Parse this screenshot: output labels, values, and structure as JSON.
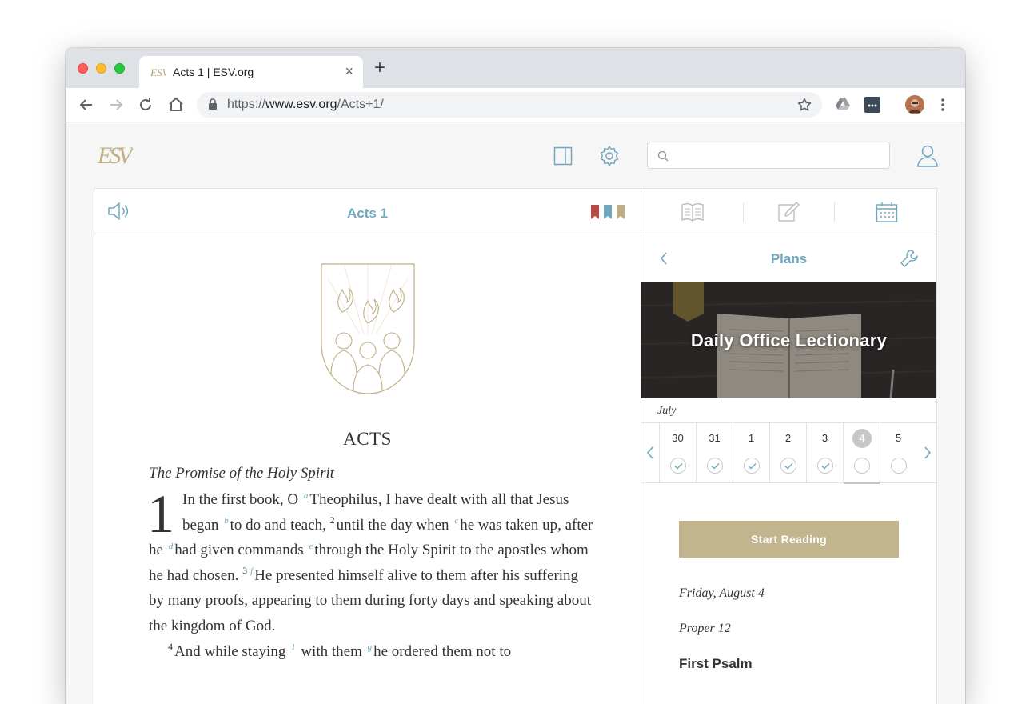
{
  "browser": {
    "tab_title": "Acts 1 | ESV.org",
    "url_scheme": "https://",
    "url_host": "www.esv.org",
    "url_path": "/Acts+1/"
  },
  "site": {
    "logo_text": "ESV",
    "search_placeholder": ""
  },
  "reader": {
    "chapter_title": "Acts 1",
    "ribbon_colors": [
      "#b84a45",
      "#6fa7be",
      "#c2ae85"
    ],
    "book_name": "ACTS",
    "section_heading": "The Promise of the Holy Spirit",
    "chapter_number": "1",
    "verses": {
      "v1a": "In the first book, O ",
      "fn_a": "a",
      "v1b": "Theophilus, I have dealt with all that Jesus began ",
      "fn_b": "b",
      "v1c": "to do and teach, ",
      "vn_2": "2",
      "v2a": "until the day when ",
      "fn_c": "c",
      "v2b": "he was taken up, after he ",
      "fn_d": "d",
      "v2c": "had given commands ",
      "fn_e": "e",
      "v2d": "through the Holy Spirit to the apostles whom he had chosen. ",
      "vn_3": "3",
      "fn_f": "f",
      "v3": "He presented himself alive to them after his suffering by many proofs, appearing to them during forty days and speaking about the kingdom of God.",
      "vn_4": "4",
      "v4a": "And while staying ",
      "fn_1": "1",
      "v4b": " with them ",
      "fn_g": "g",
      "v4c": "he ordered them not to"
    }
  },
  "side": {
    "plans_title": "Plans",
    "plan_name": "Daily Office Lectionary",
    "month": "July",
    "days": [
      {
        "num": "30",
        "done": true
      },
      {
        "num": "31",
        "done": true
      },
      {
        "num": "1",
        "done": true
      },
      {
        "num": "2",
        "done": true
      },
      {
        "num": "3",
        "done": true
      },
      {
        "num": "4",
        "done": false
      },
      {
        "num": "5",
        "done": false
      }
    ],
    "start_label": "Start Reading",
    "date": "Friday, August 4",
    "proper": "Proper 12",
    "section": "First Psalm"
  }
}
